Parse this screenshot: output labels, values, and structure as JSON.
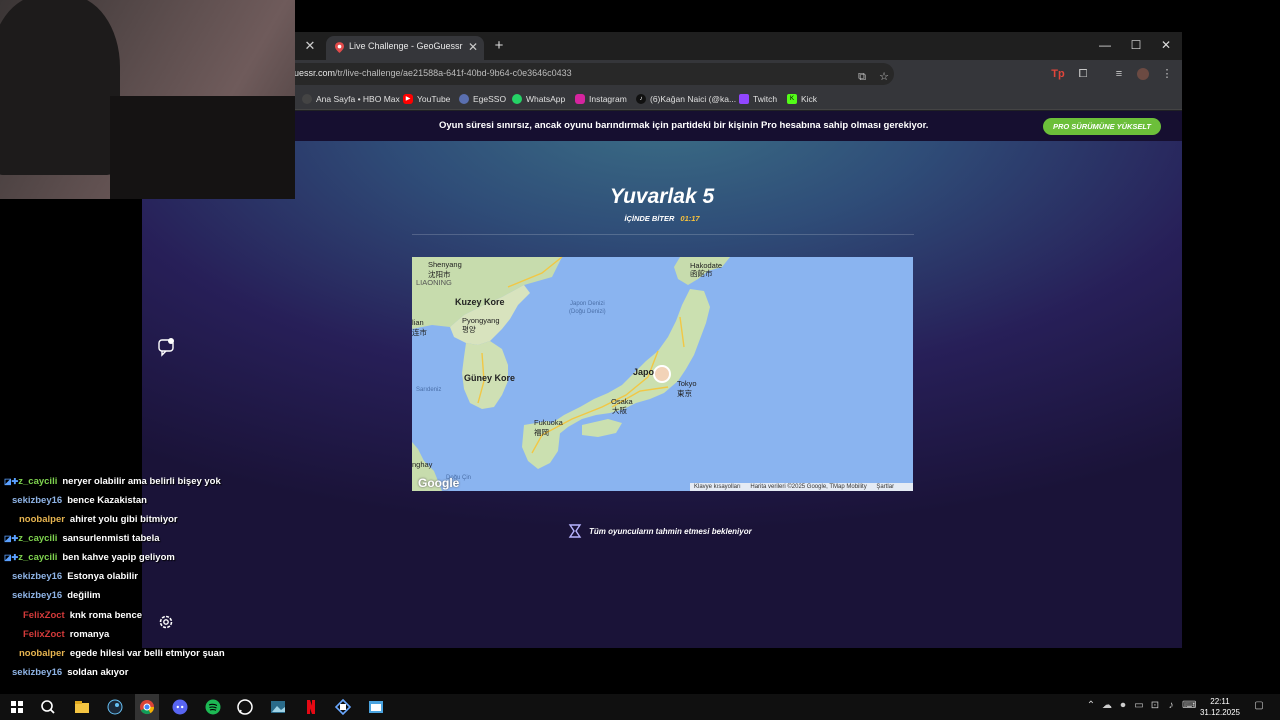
{
  "browser": {
    "tab_title": "Live Challenge - GeoGuessr",
    "url_prefix": "uessr.com",
    "url_rest": "/tr/live-challenge/ae21588a-641f-40bd-9b64-c0e3646c0433",
    "bookmarks": [
      {
        "label": "Ana Sayfa • HBO Max",
        "color": "#444444"
      },
      {
        "label": "YouTube",
        "color": "#ff0000"
      },
      {
        "label": "EgeSSO",
        "color": "#5a6fb0"
      },
      {
        "label": "WhatsApp",
        "color": "#25d366"
      },
      {
        "label": "Instagram",
        "color": "#d6249f"
      },
      {
        "label": "(6)Kağan Naici (@ka...",
        "color": "#111111"
      },
      {
        "label": "Twitch",
        "color": "#9146ff"
      },
      {
        "label": "Kick",
        "color": "#53fc18"
      }
    ]
  },
  "banner": {
    "text": "Oyun süresi sınırsız, ancak oyunu barındırmak için partideki bir kişinin Pro hesabına sahip olması gerekiyor.",
    "upgrade_label": "PRO SÜRÜMÜNE YÜKSELT",
    "upgrade_color": "#6cbf3a"
  },
  "game": {
    "round_title": "Yuvarlak 5",
    "timer_label": "İÇİNDE BİTER",
    "timer_value": "01:17",
    "waiting_text": "Tüm oyuncuların tahmin etmesi bekleniyor"
  },
  "map": {
    "labels": {
      "shenyang": "Shenyang",
      "shenyang_cn": "沈阳市",
      "liaoning": "LIAONING",
      "north_korea": "Kuzey Kore",
      "pyongyang": "Pyongyang",
      "pyongyang_kr": "평양",
      "dalian": "lian",
      "dalian_cn": "连市",
      "japan_sea": "Japon Denizi",
      "japan_sea_alt": "(Doğu Denizi)",
      "south_korea": "Güney Kore",
      "sarideniz": "Sarıdeniz",
      "hakodate": "Hakodate",
      "hakodate_jp": "函館市",
      "japan": "Japo",
      "tokyo": "Tokyo",
      "tokyo_jp": "東京",
      "osaka": "Osaka",
      "osaka_jp": "大阪",
      "fukuoka": "Fukuoka",
      "fukuoka_jp": "福岡",
      "shanghai": "nghay",
      "east_china_sea": "Doğu Çin",
      "google": "Google"
    },
    "footer": {
      "shortcuts": "Klavye kısayolları",
      "data": "Harita verileri ©2025 Google, TMap Mobility",
      "terms": "Şartlar"
    }
  },
  "chat": [
    {
      "user": "z_caycili",
      "user_color": "#7fd34f",
      "text": "neryer olabilir ama belirli bişey yok",
      "badges": true
    },
    {
      "user": "sekizbey16",
      "user_color": "#8fb4e6",
      "text": "bence Kazakistan",
      "badges": false
    },
    {
      "user": "noobalper",
      "user_color": "#e6b450",
      "text": "ahiret yolu gibi bitmiyor",
      "badges": false
    },
    {
      "user": "z_caycili",
      "user_color": "#7fd34f",
      "text": "sansurlenmisti tabela",
      "badges": true
    },
    {
      "user": "z_caycili",
      "user_color": "#7fd34f",
      "text": "ben kahve yapip geliyom",
      "badges": true
    },
    {
      "user": "sekizbey16",
      "user_color": "#8fb4e6",
      "text": "Estonya olabilir",
      "badges": false
    },
    {
      "user": "sekizbey16",
      "user_color": "#8fb4e6",
      "text": "değilim",
      "badges": false
    },
    {
      "user": "FelixZoct",
      "user_color": "#d33a3a",
      "text": "knk roma bence",
      "badges": false
    },
    {
      "user": "FelixZoct",
      "user_color": "#d33a3a",
      "text": "romanya",
      "badges": false
    },
    {
      "user": "noobalper",
      "user_color": "#e6b450",
      "text": "egede hilesi var belli etmiyor şuan",
      "badges": false
    },
    {
      "user": "sekizbey16",
      "user_color": "#8fb4e6",
      "text": "soldan akıyor",
      "badges": false
    }
  ],
  "taskbar": {
    "time": "22:11",
    "date": "31.12.2025"
  }
}
